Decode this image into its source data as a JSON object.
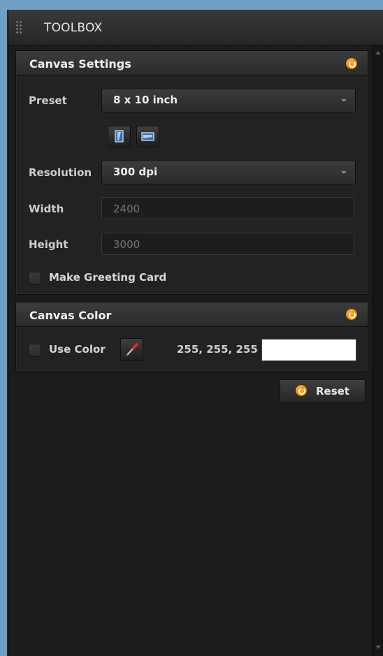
{
  "toolbox": {
    "title": "TOOLBOX"
  },
  "canvas_settings": {
    "title": "Canvas Settings",
    "preset_label": "Preset",
    "preset_value": "8 x 10 inch",
    "resolution_label": "Resolution",
    "resolution_value": "300 dpi",
    "width_label": "Width",
    "width_value": "2400",
    "height_label": "Height",
    "height_value": "3000",
    "greeting_card_label": "Make Greeting Card",
    "greeting_card_checked": false
  },
  "canvas_color": {
    "title": "Canvas Color",
    "use_color_label": "Use Color",
    "use_color_checked": false,
    "rgb_value": "255, 255, 255",
    "swatch_color": "#ffffff"
  },
  "reset_label": "Reset",
  "colors": {
    "accent": "#f08a00",
    "background": "#1c1c1c",
    "desktop": "#6f9fc4"
  },
  "icons": {
    "grip": "grip-icon",
    "section_toggle": "refresh-icon",
    "portrait": "portrait-orientation-icon",
    "landscape": "landscape-orientation-icon",
    "eyedropper": "eyedropper-icon"
  }
}
